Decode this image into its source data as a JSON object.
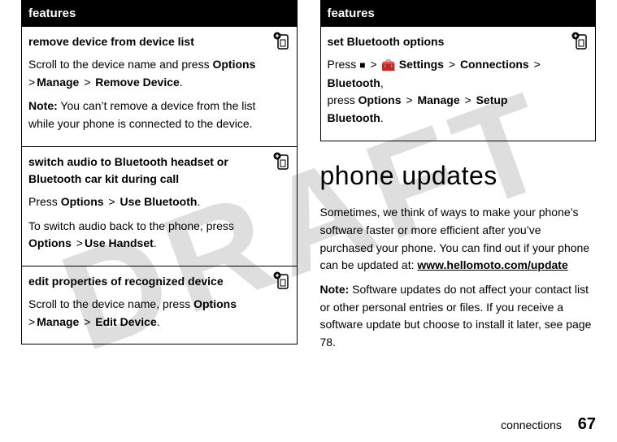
{
  "watermark": "DRAFT",
  "left": {
    "header": "features",
    "rows": [
      {
        "title": "remove device from device list",
        "parts": [
          "Scroll to the device name and press ",
          "Options",
          " >",
          "Manage",
          " > ",
          "Remove Device",
          "."
        ],
        "note_label": "Note:",
        "note_rest": " You can’t remove a device from the list while your phone is connected to the device.",
        "has_icon": true
      },
      {
        "title": "switch audio to Bluetooth headset or Bluetooth car kit during call",
        "parts": [
          "Press ",
          "Options",
          " > ",
          "Use Bluetooth",
          "."
        ],
        "extra_parts": [
          "To switch audio back to the phone, press ",
          "Options",
          " >",
          "Use Handset",
          "."
        ],
        "has_icon": true
      },
      {
        "title": "edit properties of recognized device",
        "parts": [
          "Scroll to the device name, press ",
          "Options",
          " >",
          "Manage",
          " > ",
          "Edit Device",
          "."
        ],
        "has_icon": true
      }
    ]
  },
  "right": {
    "header": "features",
    "rows": [
      {
        "title": "set Bluetooth options",
        "line1_pre": "Press ",
        "line1_glyph_s": "s",
        "line1_mid": " > ",
        "line1_tool": "u",
        "line1_settings": "Settings",
        "line1_after": " > ",
        "line1_conn": "Connections",
        "line1_after2": " > ",
        "line1_bt": "Bluetooth",
        "line1_comma": ",",
        "line2_pre": "press ",
        "line2_options": "Options",
        "line2_a": " > ",
        "line2_manage": "Manage",
        "line2_b": " > ",
        "line2_setup": "Setup Bluetooth",
        "line2_dot": ".",
        "has_icon": true
      }
    ]
  },
  "section": {
    "heading": "phone updates",
    "p1a": "Sometimes, we think of ways to make your phone’s software faster or more efficient after you’ve purchased your phone. You can find out if your phone can be updated at: ",
    "p1link": "www.hellomoto.com/update",
    "p2_label": "Note:",
    "p2_rest": " Software updates do not affect your contact list or other personal entries or files. If you receive a software update but choose to install it later, see page 78."
  },
  "footer": {
    "label": "connections",
    "page": "67"
  }
}
